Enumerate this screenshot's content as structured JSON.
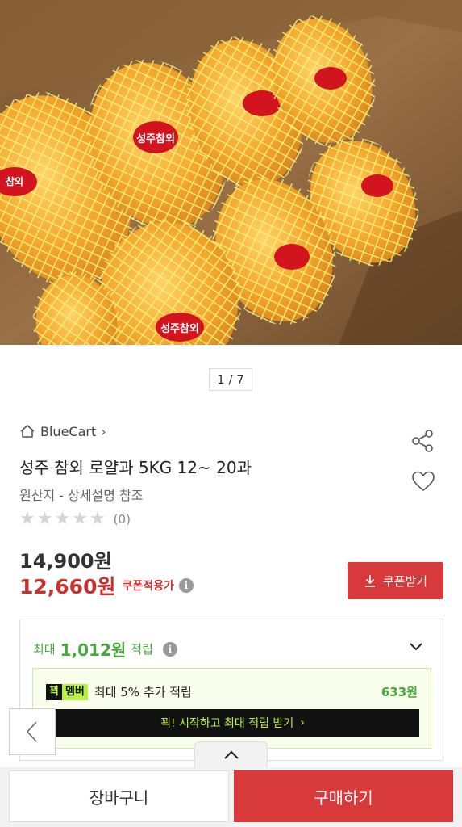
{
  "gallery": {
    "pager": "1 / 7",
    "sticker_label": "성주 참외"
  },
  "store": {
    "name": "BlueCart",
    "chevron": "›"
  },
  "product": {
    "title": "성주 참외 로얄과 5KG 12~ 20과",
    "origin": "원산지 - 상세설명 참조",
    "rating_count": "(0)",
    "rating_value": 0,
    "rating_max": 5
  },
  "price": {
    "original": "14,900원",
    "sale": "12,660원",
    "sale_note": "쿠폰적용가",
    "info": "i"
  },
  "coupon": {
    "label": "쿠폰받기"
  },
  "points": {
    "prefix": "최대",
    "amount": "1,012원",
    "suffix": "적립",
    "info": "i"
  },
  "member": {
    "badge_part1": "꾁",
    "badge_part2": "멤버",
    "text": "최대 5% 추가 적립",
    "points": "633원",
    "cta": "꾁! 시작하고 최대 적립 받기",
    "cta_chevron": "›"
  },
  "bottom": {
    "cart": "장바구니",
    "buy": "구매하기"
  },
  "colors": {
    "accent_red": "#d8393a",
    "points_green": "#48a83b",
    "member_lime": "#b6f040"
  },
  "icons": {
    "home": "home-icon",
    "share": "share-icon",
    "heart": "heart-icon",
    "download": "download-icon",
    "chevron_down": "chevron-down-icon",
    "chevron_up": "chevron-up-icon",
    "chevron_left": "chevron-left-icon"
  }
}
